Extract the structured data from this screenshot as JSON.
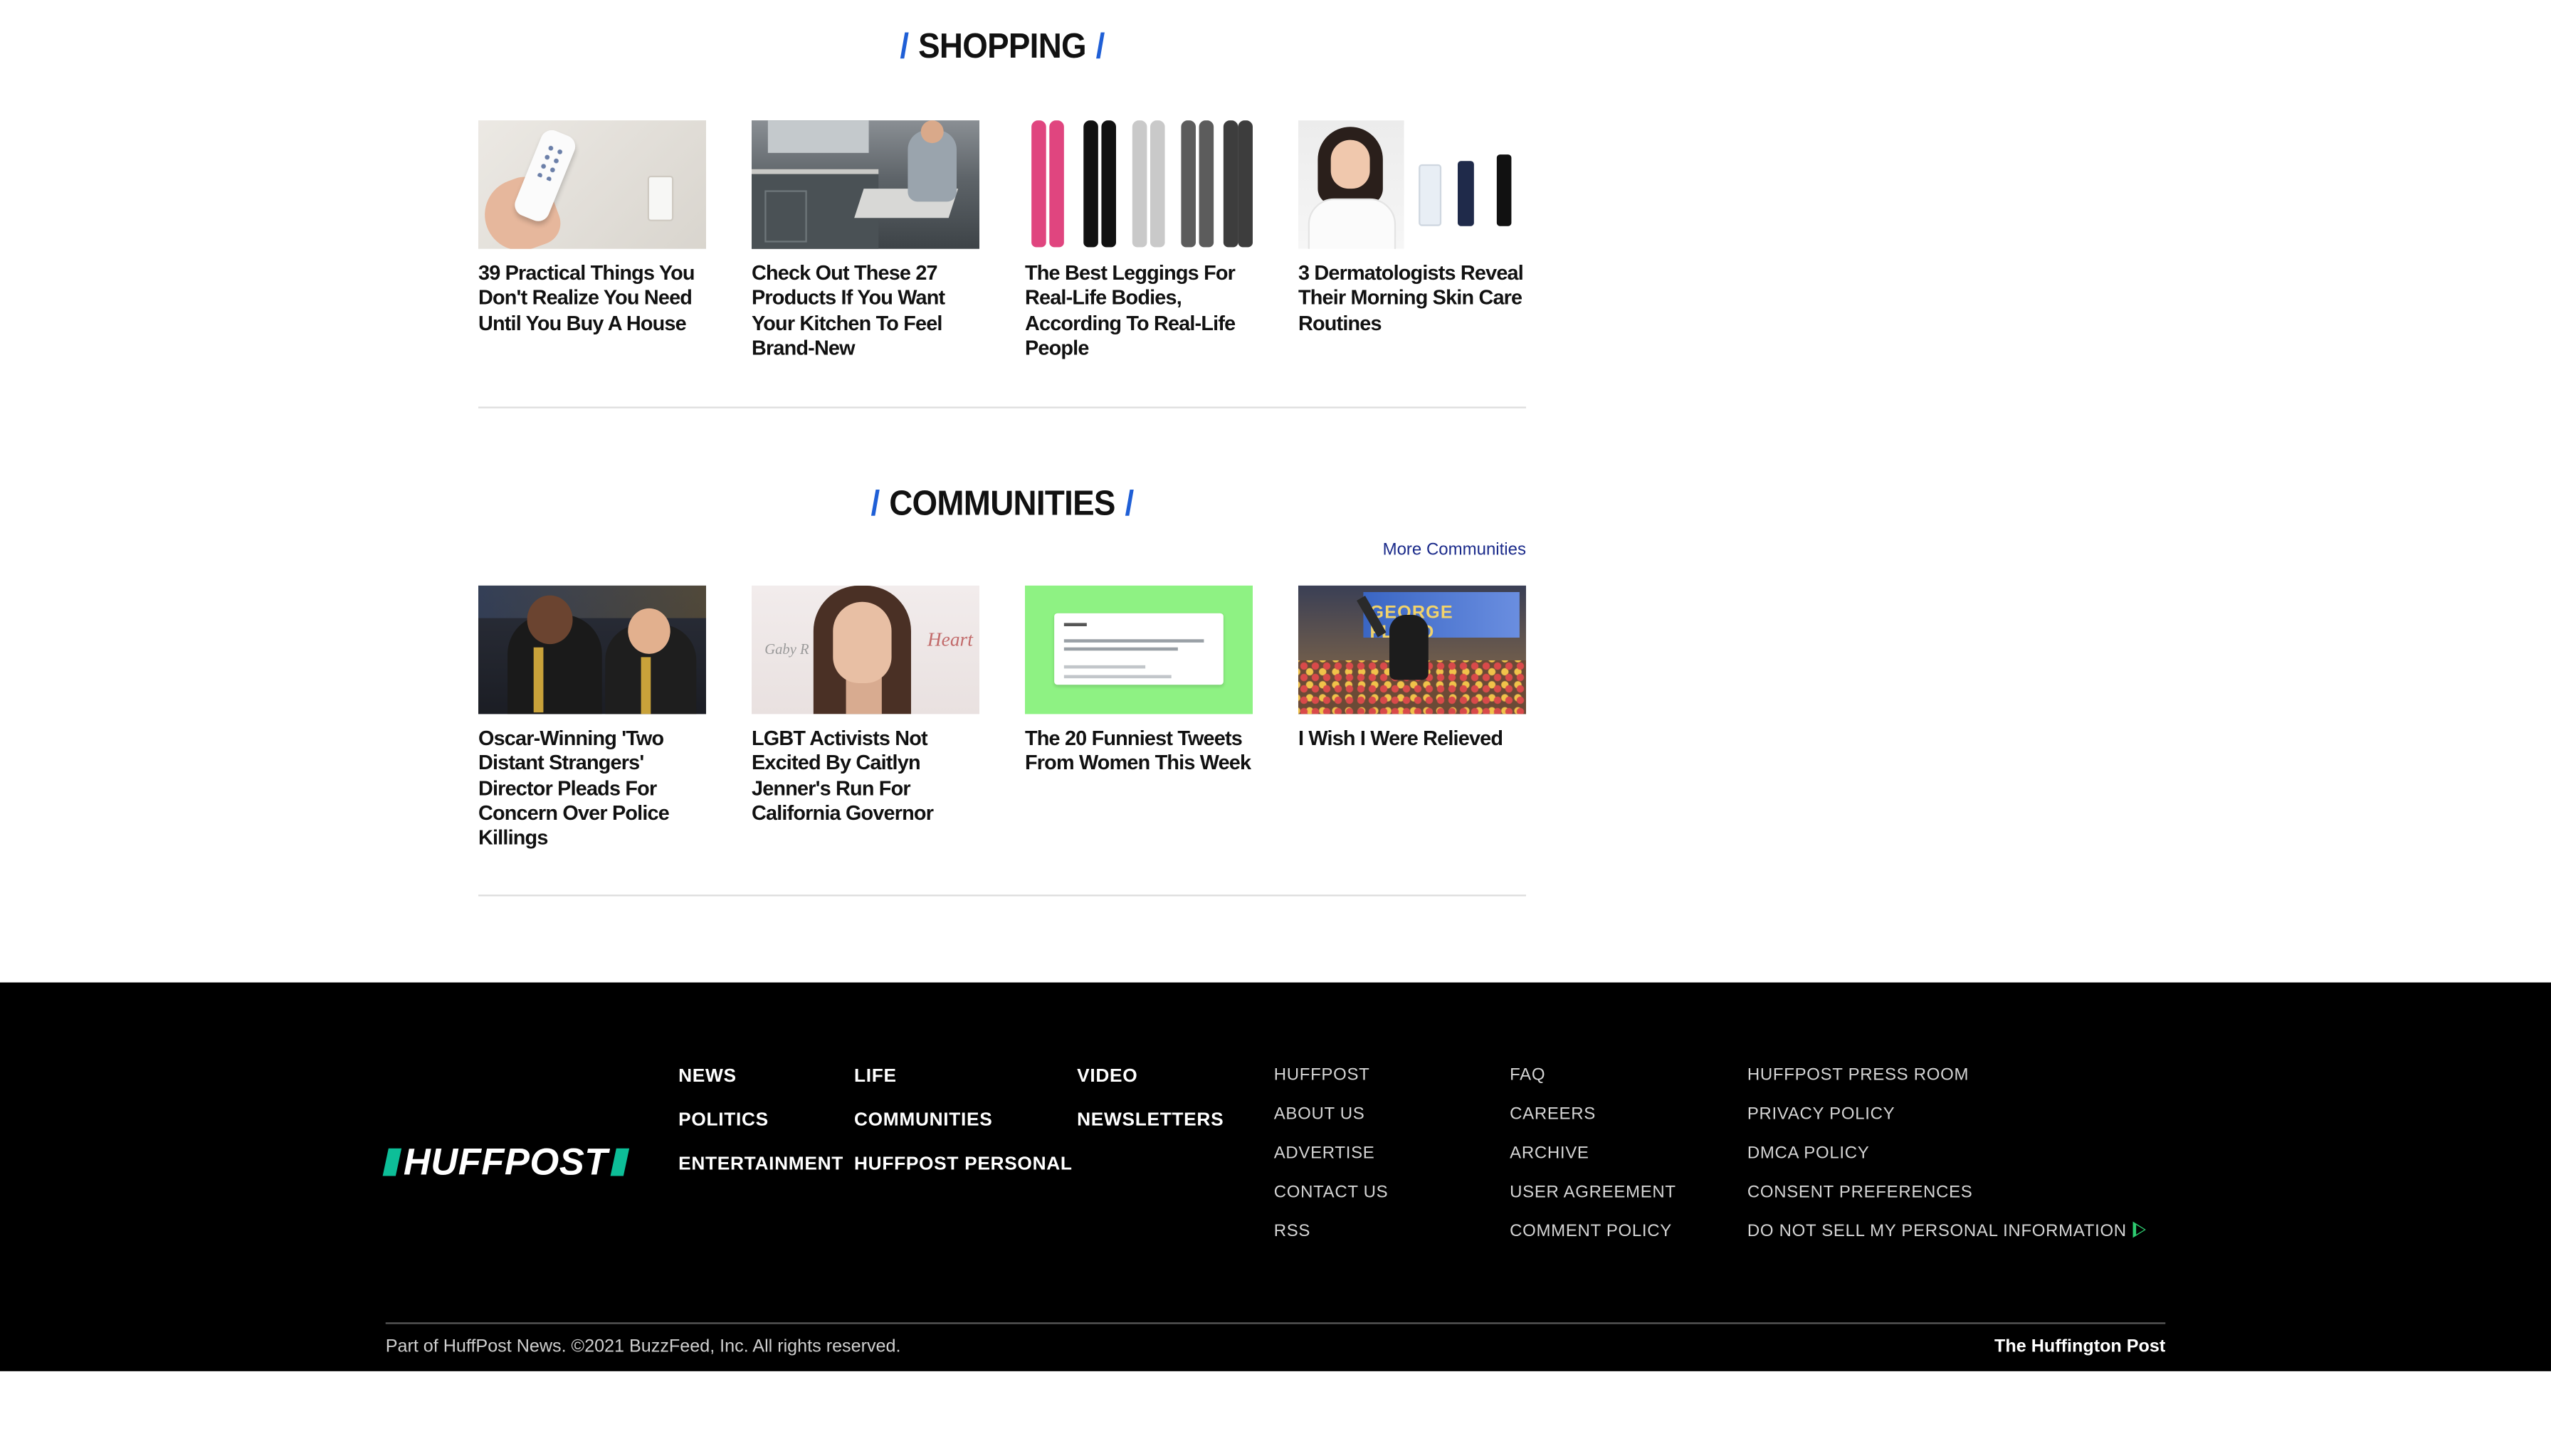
{
  "shopping": {
    "title": "SHOPPING",
    "slash": "/",
    "cards": [
      {
        "title": "39 Practical Things You Don't Realize You Need Until You Buy A House"
      },
      {
        "title": "Check Out These 27 Products If You Want Your Kitchen To Feel Brand-New"
      },
      {
        "title": "The Best Leggings For Real-Life Bodies, According To Real-Life People"
      },
      {
        "title": "3 Dermatologists Reveal Their Morning Skin Care Routines"
      }
    ]
  },
  "communities": {
    "title": "COMMUNITIES",
    "slash": "/",
    "more_link": "More Communities",
    "cards": [
      {
        "title": "Oscar-Winning 'Two Distant Strangers' Director Pleads For Concern Over Police Killings"
      },
      {
        "title": "LGBT Activists Not Excited By Caitlyn Jenner's Run For California Governor"
      },
      {
        "title": "The 20 Funniest Tweets From Women This Week"
      },
      {
        "title": "I Wish I Were Relieved"
      }
    ],
    "thumb_text": {
      "caitlyn_logo_left": "Gaby R",
      "caitlyn_logo_right": "Heart"
    }
  },
  "footer": {
    "logo_text": "HUFFPOST",
    "nav": {
      "col1": [
        "NEWS",
        "POLITICS",
        "ENTERTAINMENT"
      ],
      "col2": [
        "LIFE",
        "COMMUNITIES",
        "HUFFPOST PERSONAL"
      ],
      "col3": [
        "VIDEO",
        "NEWSLETTERS"
      ]
    },
    "links": {
      "col1": [
        "HUFFPOST",
        "ABOUT US",
        "ADVERTISE",
        "CONTACT US",
        "RSS"
      ],
      "col2": [
        "FAQ",
        "CAREERS",
        "ARCHIVE",
        "USER AGREEMENT",
        "COMMENT POLICY"
      ],
      "col3": [
        "HUFFPOST PRESS ROOM",
        "PRIVACY POLICY",
        "DMCA POLICY",
        "CONSENT PREFERENCES",
        "DO NOT SELL MY PERSONAL INFORMATION"
      ]
    },
    "copyright": "Part of HuffPost News. ©2021 BuzzFeed, Inc. All rights reserved.",
    "brand": "The Huffington Post"
  },
  "colors": {
    "accent_blue": "#1f5fd6",
    "brand_green": "#0dbe98",
    "link_blue": "#1a2a8a",
    "footer_bg": "#000000"
  },
  "icons": {
    "privacy_options": "privacy-options-icon"
  }
}
